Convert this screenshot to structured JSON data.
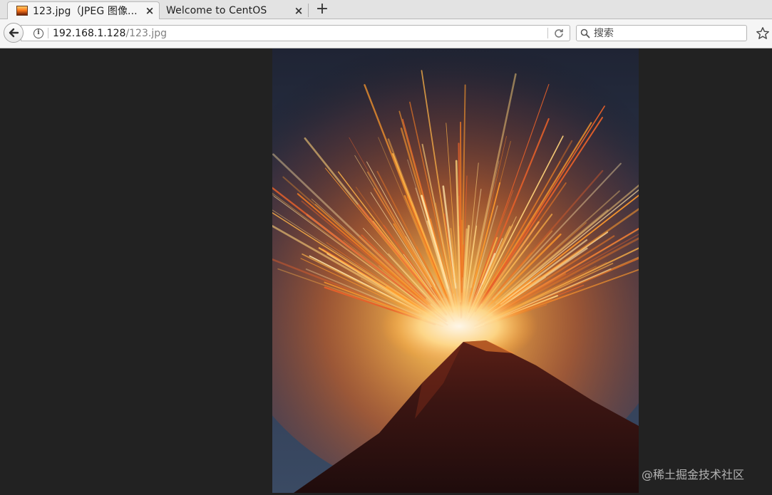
{
  "tabs": [
    {
      "title": "123.jpg（JPEG 图像...",
      "active": true,
      "favicon": "image-thumbnail-icon"
    },
    {
      "title": "Welcome to CentOS",
      "active": false
    }
  ],
  "tab_close_glyph": "×",
  "new_tab_glyph": "+",
  "navigation": {
    "url_host": "192.168.1.128",
    "url_path": "/123.jpg",
    "info_glyph": "i",
    "search_placeholder": "搜索"
  },
  "content": {
    "image_subject": "volcano-eruption-photo",
    "watermark": "@稀土掘金技术社区"
  },
  "colors": {
    "viewer_background": "#222222",
    "tab_bar": "#e3e3e3",
    "toolbar": "#f5f5f5",
    "sky": "#2b3448",
    "lava": "#ff8a1c"
  }
}
